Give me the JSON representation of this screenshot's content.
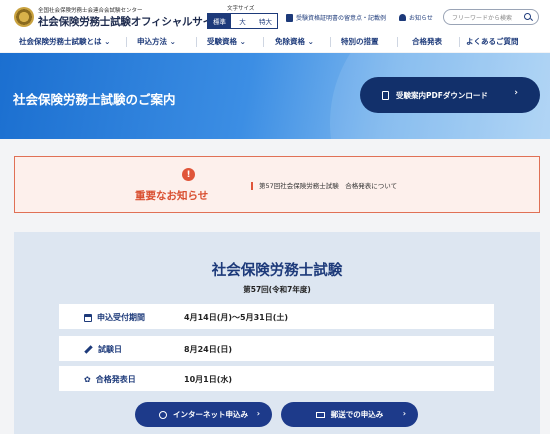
{
  "header": {
    "org_name": "全国社会保険労務士会連合会試験センター",
    "site_title": "社会保険労務士試験オフィシャルサイト",
    "font_size_label": "文字サイズ",
    "font_sizes": [
      "標準",
      "大",
      "特大"
    ],
    "link_certificate": "受験資格証明書の留意点・記載例",
    "link_notice": "お知らせ",
    "search_placeholder": "フリーワードから検索"
  },
  "nav": {
    "items": [
      "社会保険労務士試験とは",
      "申込方法",
      "受験資格",
      "免除資格",
      "特別の措置",
      "合格発表",
      "よくあるご質問"
    ]
  },
  "hero": {
    "title": "社会保険労務士試験のご案内",
    "pdf_button": "受験案内PDFダウンロード"
  },
  "notice": {
    "title": "重要なお知らせ",
    "link": "第57回社会保険労務士試験　合格発表について"
  },
  "exam": {
    "title": "社会保険労務士試験",
    "subtitle": "第57回(令和7年度)",
    "rows": [
      {
        "label": "申込受付期間",
        "value": "4月14日(月)～5月31日(土)"
      },
      {
        "label": "試験日",
        "value": "8月24日(日)"
      },
      {
        "label": "合格発表日",
        "value": "10月1日(水)"
      }
    ],
    "internet_button": "インターネット申込み",
    "mail_button": "郵送での申込み"
  },
  "colors": {
    "brand": "#1d3a7a",
    "alert": "#d94f30",
    "hero_start": "#1b6fd0",
    "hero_end": "#a9d1f4"
  }
}
